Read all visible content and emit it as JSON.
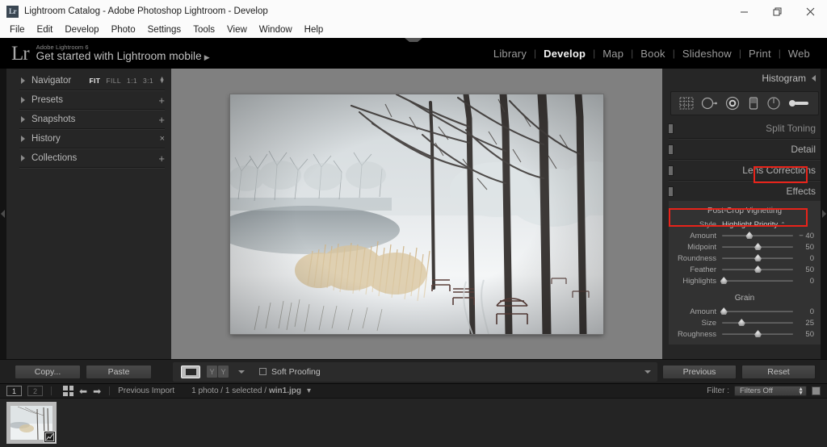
{
  "window": {
    "app_icon_text": "Lr",
    "title": "Lightroom Catalog - Adobe Photoshop Lightroom - Develop",
    "controls": {
      "minimize": "minimize-icon",
      "restore": "restore-icon",
      "close": "close-icon"
    }
  },
  "menubar": [
    "File",
    "Edit",
    "Develop",
    "Photo",
    "Settings",
    "Tools",
    "View",
    "Window",
    "Help"
  ],
  "identity": {
    "logo": "Lr",
    "product": "Adobe Lightroom 6",
    "tagline": "Get started with Lightroom mobile",
    "tagline_arrow": "▶"
  },
  "modules": [
    {
      "label": "Library",
      "active": false
    },
    {
      "label": "Develop",
      "active": true
    },
    {
      "label": "Map",
      "active": false
    },
    {
      "label": "Book",
      "active": false
    },
    {
      "label": "Slideshow",
      "active": false
    },
    {
      "label": "Print",
      "active": false
    },
    {
      "label": "Web",
      "active": false
    }
  ],
  "left_panel": {
    "navigator": {
      "label": "Navigator",
      "zoom_levels": [
        {
          "label": "FIT",
          "selected": true
        },
        {
          "label": "FILL",
          "selected": false
        },
        {
          "label": "1:1",
          "selected": false
        },
        {
          "label": "3:1",
          "selected": false
        }
      ]
    },
    "items": [
      {
        "label": "Presets",
        "action": "+"
      },
      {
        "label": "Snapshots",
        "action": "+"
      },
      {
        "label": "History",
        "action": "×"
      },
      {
        "label": "Collections",
        "action": "+"
      }
    ]
  },
  "right_panel": {
    "histogram": {
      "label": "Histogram"
    },
    "tools": [
      "crop-overlay-icon",
      "spot-removal-icon",
      "red-eye-icon",
      "graduated-filter-icon",
      "radial-filter-icon",
      "adjustment-brush-icon"
    ],
    "groups": [
      {
        "label": "Split Toning",
        "expanded": false,
        "clipped": true
      },
      {
        "label": "Detail",
        "expanded": false,
        "clipped": false
      },
      {
        "label": "Lens Corrections",
        "expanded": false,
        "clipped": false
      },
      {
        "label": "Effects",
        "expanded": true,
        "clipped": false,
        "highlighted": true
      }
    ],
    "effects": {
      "vignetting_title": "Post-Crop Vignetting",
      "style_label": "Style",
      "style_value": "Highlight Priority",
      "sliders": [
        {
          "name": "Amount",
          "value": "− 40",
          "pos": 38,
          "highlighted": true
        },
        {
          "name": "Midpoint",
          "value": "50",
          "pos": 50,
          "highlighted": false
        },
        {
          "name": "Roundness",
          "value": "0",
          "pos": 50,
          "highlighted": false
        },
        {
          "name": "Feather",
          "value": "50",
          "pos": 50,
          "highlighted": false
        },
        {
          "name": "Highlights",
          "value": "0",
          "pos": 2,
          "highlighted": false
        }
      ],
      "grain_title": "Grain",
      "grain_sliders": [
        {
          "name": "Amount",
          "value": "0",
          "pos": 2
        },
        {
          "name": "Size",
          "value": "25",
          "pos": 27
        },
        {
          "name": "Roughness",
          "value": "50",
          "pos": 50
        }
      ]
    }
  },
  "toolbar": {
    "copy_label": "Copy...",
    "paste_label": "Paste",
    "view_icon": "loupe-view-icon",
    "compare_left": "Y",
    "compare_right": "Y",
    "soft_proofing_label": "Soft Proofing",
    "soft_proofing_checked": false,
    "previous_label": "Previous",
    "reset_label": "Reset",
    "dropdown_icon": "chevron-down-icon"
  },
  "filmstrip": {
    "monitor_buttons": [
      "1",
      "2"
    ],
    "grid_icon": "grid-view-icon",
    "back_icon": "arrow-left-icon",
    "forward_icon": "arrow-right-icon",
    "source": "Previous Import",
    "count_prefix": "1 photo / 1 selected /",
    "filename": "win1.jpg",
    "filename_caret": "▾",
    "filter_label": "Filter :",
    "filter_value": "Filters Off",
    "thumbnail_badge": "develop-adjustment-icon"
  },
  "colors": {
    "highlight": "#e8231a",
    "panel_bg": "#262626",
    "canvas_bg": "#808080",
    "titlebar_bg": "#fbfbfb"
  }
}
